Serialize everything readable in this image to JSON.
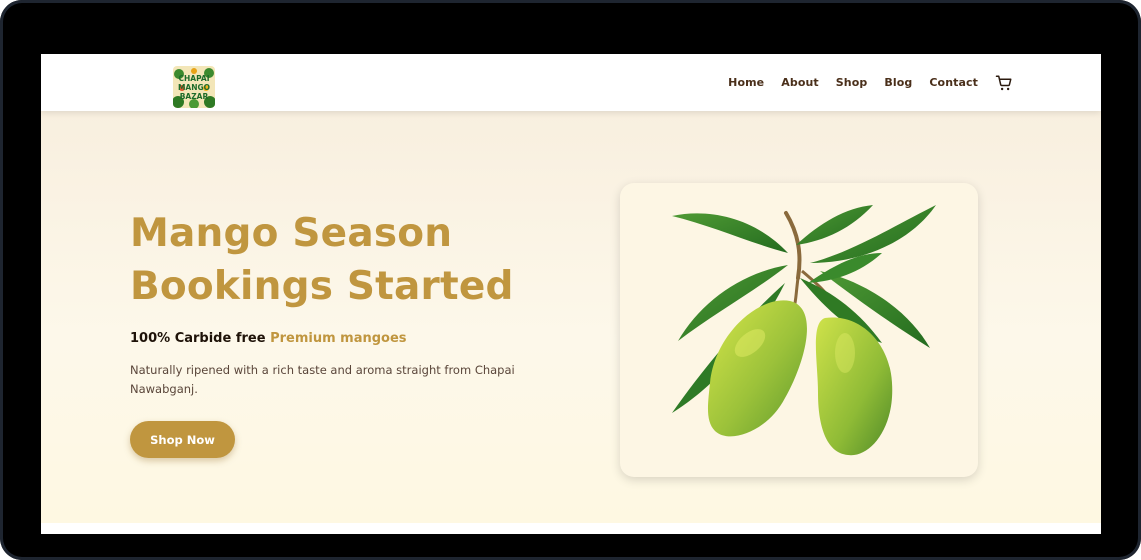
{
  "brand": {
    "logo_text": "CHAPAI MANGO BAZAR"
  },
  "nav": {
    "items": [
      {
        "label": "Home"
      },
      {
        "label": "About"
      },
      {
        "label": "Shop"
      },
      {
        "label": "Blog"
      },
      {
        "label": "Contact"
      }
    ],
    "cart_icon": "cart-icon"
  },
  "hero": {
    "title": "Mango Season Bookings Started",
    "subtitle_prefix": "100% Carbide free",
    "subtitle_accent": "Premium mangoes",
    "description": "Naturally ripened with a rich taste and aroma straight from Chapai Nawabganj.",
    "cta_label": "Shop Now",
    "image_subject": "green-mangoes-with-leaves"
  },
  "colors": {
    "accent": "#c0963f",
    "nav_text": "#4a2f1a",
    "hero_bg": "#fdf8ea",
    "device_frame": "#000000"
  }
}
